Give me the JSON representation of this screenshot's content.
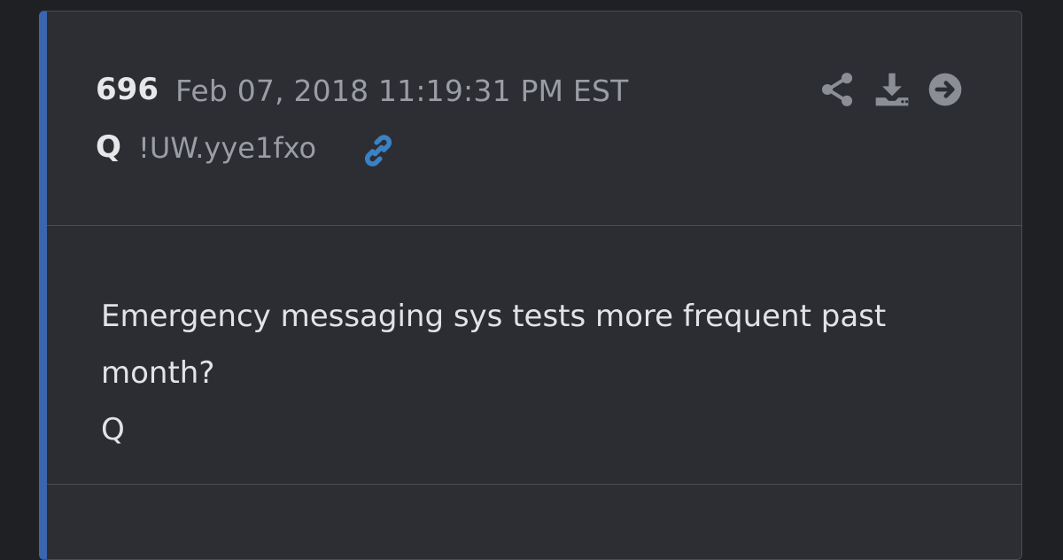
{
  "post": {
    "number": "696",
    "date": "Feb 07, 2018 11:19:31 PM EST",
    "author": "Q",
    "tripcode": "!UW.yye1fxo",
    "message_lines": [
      "Emergency messaging sys tests more frequent past",
      "month?",
      "Q"
    ]
  },
  "icons": {
    "link": "link-icon",
    "share": "share-icon",
    "download": "download-icon",
    "open": "arrow-right-circle-icon"
  },
  "colors": {
    "page_background": "#1f2023",
    "card_background": "#2c2e33",
    "accent_border": "#3a66b0",
    "link_icon": "#3b82c4",
    "muted_text": "#9a9da3"
  }
}
